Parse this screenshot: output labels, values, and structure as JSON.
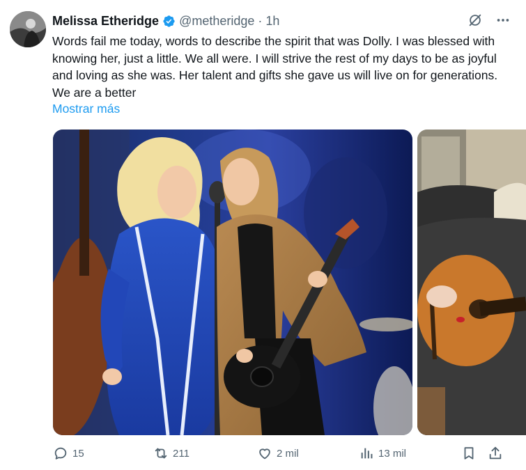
{
  "tweet": {
    "author_name": "Melissa Etheridge",
    "handle": "@metheridge",
    "separator": "·",
    "time": "1h",
    "text": "Words fail me today, words to describe the spirit that was Dolly. I was blessed with knowing her, just a little. We all were. I will strive the rest of my days to be as joyful and loving as she was. Her talent and gifts she gave us will live on for generations. We are a better",
    "show_more": "Mostrar más"
  },
  "icons": {
    "verified": "verified-badge-icon",
    "grok": "grok-icon",
    "more": "more-icon",
    "reply": "reply-icon",
    "repost": "repost-icon",
    "like": "like-icon",
    "views": "views-icon",
    "bookmark": "bookmark-icon",
    "share": "share-icon"
  },
  "colors": {
    "accent": "#1d9bf0",
    "secondary_text": "#536471",
    "primary_text": "#0f1419"
  },
  "actions": {
    "replies": "15",
    "reposts": "211",
    "likes": "2 mil",
    "views": "13 mil"
  }
}
